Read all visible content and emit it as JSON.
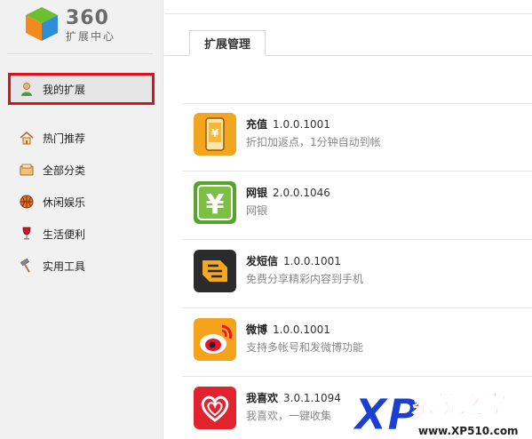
{
  "logo": {
    "number": "360",
    "subtitle": "扩展中心"
  },
  "sidebar": {
    "active": {
      "label": "我的扩展",
      "icon": "user-icon"
    },
    "items": [
      {
        "label": "热门推荐",
        "icon": "home-icon"
      },
      {
        "label": "全部分类",
        "icon": "tray-icon"
      },
      {
        "label": "休闲娱乐",
        "icon": "basketball-icon"
      },
      {
        "label": "生活便利",
        "icon": "wine-glass-icon"
      },
      {
        "label": "实用工具",
        "icon": "hammer-icon"
      }
    ]
  },
  "main": {
    "tab": "扩展管理",
    "extensions": [
      {
        "name": "充值",
        "version": "1.0.0.1001",
        "desc": "折扣加返点，1分钟自动到帐",
        "icon": "phone-yen-icon"
      },
      {
        "name": "网银",
        "version": "2.0.0.1046",
        "desc": "网银",
        "icon": "yen-icon"
      },
      {
        "name": "发短信",
        "version": "1.0.0.1001",
        "desc": "免费分享精彩内容到手机",
        "icon": "sms-icon"
      },
      {
        "name": "微博",
        "version": "1.0.0.1001",
        "desc": "支持多帐号和发微博功能",
        "icon": "weibo-icon"
      },
      {
        "name": "我喜欢",
        "version": "3.0.1.1094",
        "desc": "我喜欢，一键收集",
        "icon": "heart-icon"
      }
    ]
  },
  "watermark": {
    "brand": "系统之家",
    "url": "www.XP510.com",
    "xp": "XP"
  },
  "colors": {
    "highlight_border": "#e0101a",
    "sidebar_bg": "#f1f1f1"
  }
}
